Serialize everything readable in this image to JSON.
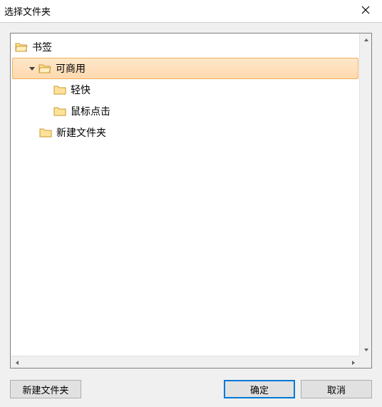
{
  "title": "选择文件夹",
  "tree": {
    "root": {
      "label": "书签",
      "open": true
    },
    "items": [
      {
        "label": "可商用",
        "depth": 1,
        "selected": true,
        "open": true,
        "hasChildren": true
      },
      {
        "label": "轻快",
        "depth": 2,
        "selected": false,
        "open": false,
        "hasChildren": false
      },
      {
        "label": "鼠标点击",
        "depth": 2,
        "selected": false,
        "open": false,
        "hasChildren": false
      },
      {
        "label": "新建文件夹",
        "depth": 1,
        "selected": false,
        "open": false,
        "hasChildren": false
      }
    ]
  },
  "buttons": {
    "newFolder": "新建文件夹",
    "ok": "确定",
    "cancel": "取消"
  }
}
